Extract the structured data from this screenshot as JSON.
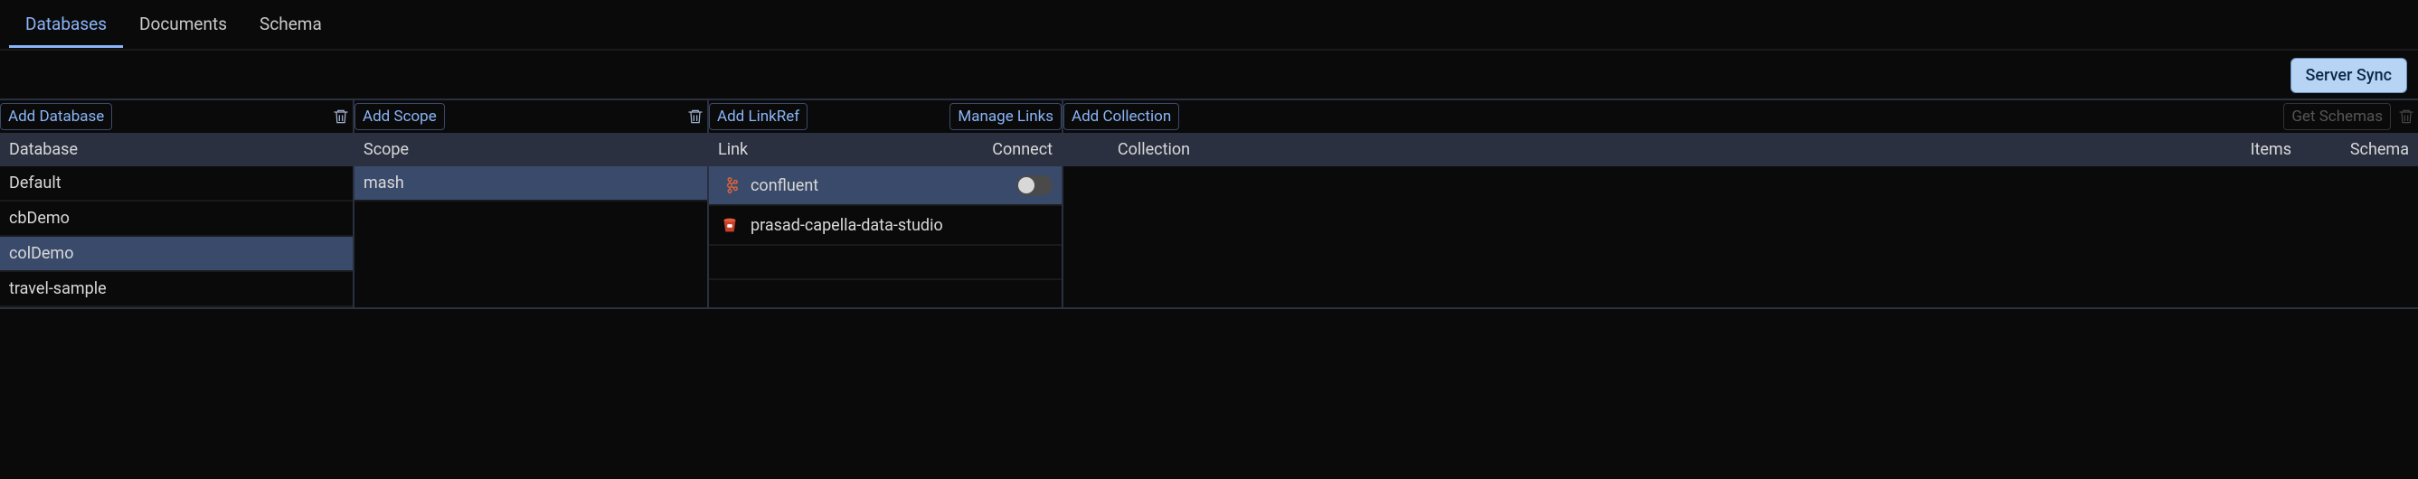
{
  "tabs": {
    "databases": "Databases",
    "documents": "Documents",
    "schema": "Schema",
    "active": "databases"
  },
  "sync": {
    "label": "Server Sync"
  },
  "columns": {
    "database": {
      "add_label": "Add Database",
      "header": "Database",
      "rows": [
        {
          "label": "Default",
          "selected": false
        },
        {
          "label": "cbDemo",
          "selected": false
        },
        {
          "label": "colDemo",
          "selected": true
        },
        {
          "label": "travel-sample",
          "selected": false
        }
      ]
    },
    "scope": {
      "add_label": "Add Scope",
      "header": "Scope",
      "rows": [
        {
          "label": "mash",
          "selected": true
        }
      ]
    },
    "link": {
      "add_label": "Add LinkRef",
      "manage_label": "Manage Links",
      "header_left": "Link",
      "header_right": "Connect",
      "rows": [
        {
          "label": "confluent",
          "icon": "kafka",
          "selected": true,
          "toggled": false
        },
        {
          "label": "prasad-capella-data-studio",
          "icon": "s3-bucket",
          "selected": false,
          "toggled": null
        }
      ]
    },
    "collection": {
      "add_label": "Add Collection",
      "get_schemas_label": "Get Schemas",
      "header_collection": "Collection",
      "header_items": "Items",
      "header_schema": "Schema",
      "rows": []
    }
  }
}
